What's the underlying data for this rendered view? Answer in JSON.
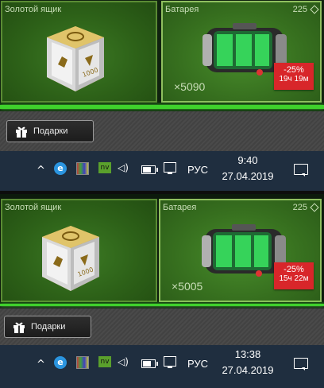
{
  "screens": [
    {
      "left_card": {
        "title": "Золотой ящик",
        "item": "gold-box-icon"
      },
      "right_card": {
        "title": "Батарея",
        "price": "225",
        "quantity": "×5090",
        "discount": "-25%",
        "timer": "19ч 19м",
        "item": "battery-icon"
      },
      "gifts_button": {
        "label": "Подарки"
      },
      "taskbar": {
        "language": "РУС",
        "time": "9:40",
        "date": "27.04.2019"
      }
    },
    {
      "left_card": {
        "title": "Золотой ящик",
        "item": "gold-box-icon"
      },
      "right_card": {
        "title": "Батарея",
        "price": "225",
        "quantity": "×5005",
        "discount": "-25%",
        "timer": "15ч 22м",
        "item": "battery-icon"
      },
      "gifts_button": {
        "label": "Подарки"
      },
      "taskbar": {
        "language": "РУС",
        "time": "13:38",
        "date": "27.04.2019"
      }
    }
  ],
  "colors": {
    "accent_green": "#3fd12c",
    "discount_red": "#d8262a",
    "taskbar_bg": "#1f2e3f"
  }
}
